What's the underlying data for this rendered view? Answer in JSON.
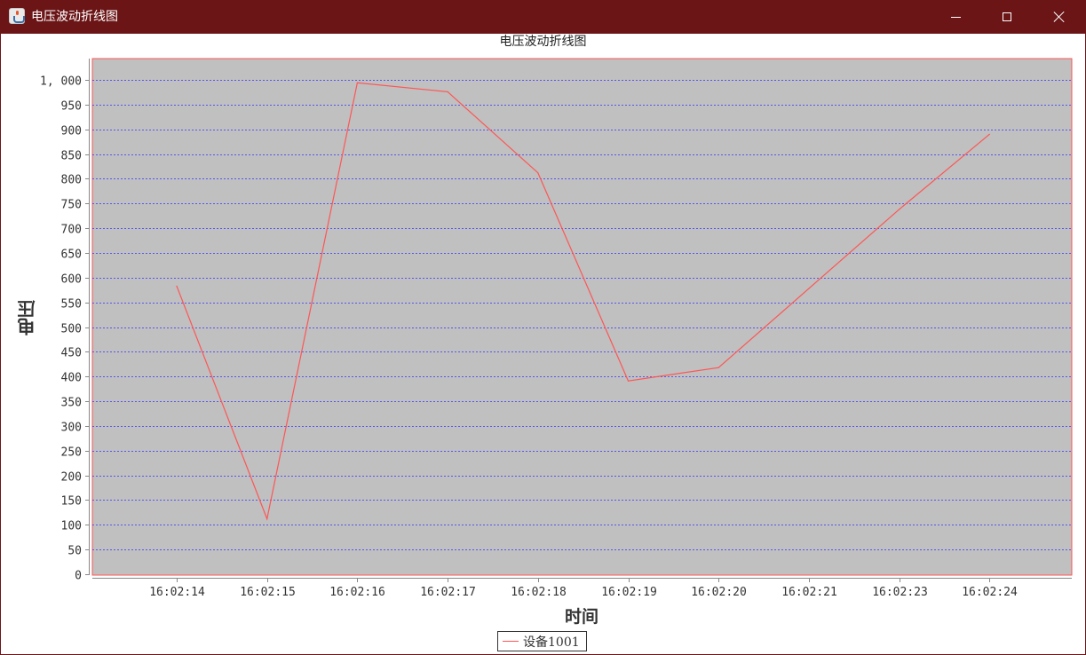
{
  "window": {
    "title": "电压波动折线图",
    "minimize_icon": "minimize-icon",
    "maximize_icon": "maximize-icon",
    "close_icon": "close-icon",
    "frame_color": "#6b1517"
  },
  "chart_data": {
    "type": "line",
    "title": "电压波动折线图",
    "xlabel": "时间",
    "ylabel": "电压",
    "categories": [
      "16:02:14",
      "16:02:15",
      "16:02:16",
      "16:02:17",
      "16:02:18",
      "16:02:19",
      "16:02:20",
      "16:02:21",
      "16:02:23",
      "16:02:24"
    ],
    "series": [
      {
        "name": "设备1001",
        "color": "#ff5555",
        "values": [
          583,
          112,
          994,
          976,
          812,
          391,
          418,
          578,
          738,
          890
        ]
      }
    ],
    "ylim": [
      0,
      1000
    ],
    "yticks": [
      0,
      50,
      100,
      150,
      200,
      250,
      300,
      350,
      400,
      450,
      500,
      550,
      600,
      650,
      700,
      750,
      800,
      850,
      900,
      950,
      1000
    ],
    "ytick_labels": [
      "0",
      "50",
      "100",
      "150",
      "200",
      "250",
      "300",
      "350",
      "400",
      "450",
      "500",
      "550",
      "600",
      "650",
      "700",
      "750",
      "800",
      "850",
      "900",
      "950",
      "1, 000"
    ],
    "grid": true,
    "grid_color": "#3333ff",
    "plot_background": "#c0c0c0",
    "legend_position": "bottom-center"
  }
}
